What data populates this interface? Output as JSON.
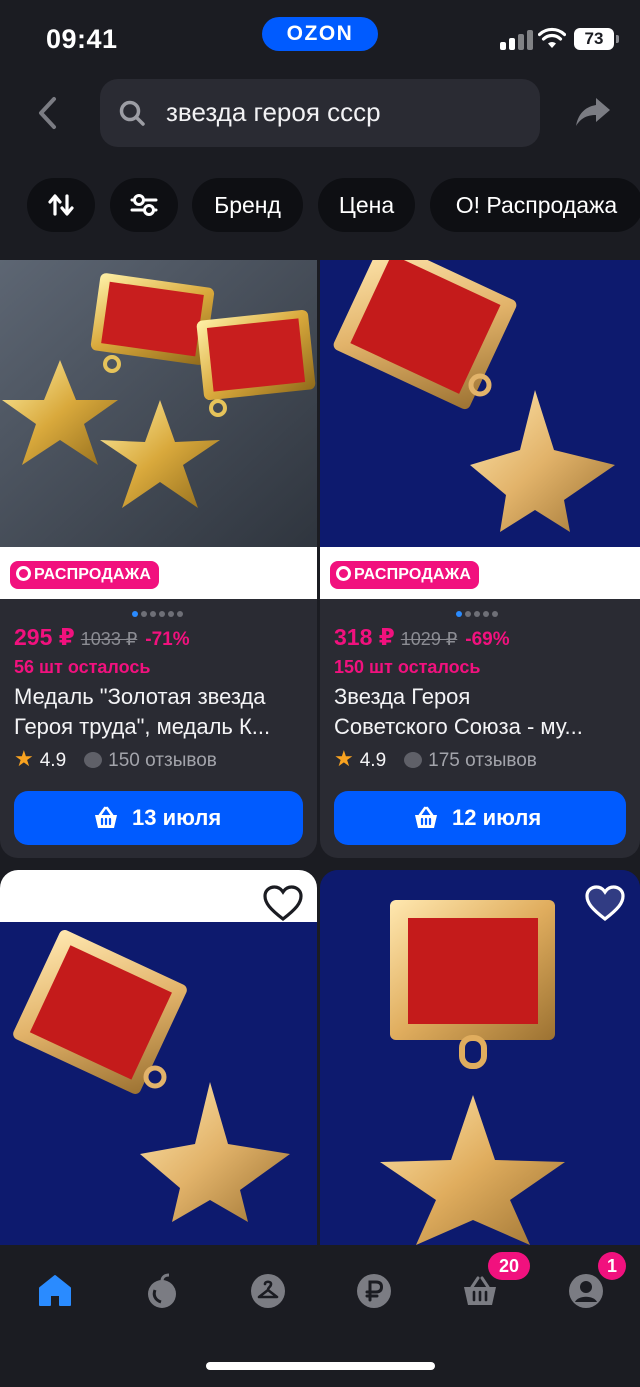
{
  "status_bar": {
    "time": "09:41",
    "brand": "OZON",
    "battery": "73"
  },
  "search": {
    "query": "звезда героя ссср"
  },
  "filters": [
    {
      "label": "",
      "icon": "sort-icon"
    },
    {
      "label": "",
      "icon": "filter-sliders-icon"
    },
    {
      "label": "Бренд"
    },
    {
      "label": "Цена"
    },
    {
      "label": "O! Распродажа"
    }
  ],
  "products": [
    {
      "badge": "РАСПРОДАЖА",
      "price": "295 ₽",
      "old_price": "1033 ₽",
      "discount": "-71%",
      "stock": "56 шт осталось",
      "title_line1": "Медаль \"Золотая звезда",
      "title_line2": "Героя труда\", медаль К...",
      "rating": "4.9",
      "reviews": "150 отзывов",
      "delivery": "13 июля"
    },
    {
      "badge": "РАСПРОДАЖА",
      "price": "318 ₽",
      "old_price": "1029 ₽",
      "discount": "-69%",
      "stock": "150 шт осталось",
      "title_line1": "Звезда Героя",
      "title_line2": "Советского Союза - му...",
      "rating": "4.9",
      "reviews": "175 отзывов",
      "delivery": "12 июля"
    }
  ],
  "bottom_nav": {
    "items": [
      "home-icon",
      "fresh-icon",
      "hanger-icon",
      "ruble-icon",
      "cart-icon",
      "profile-icon"
    ],
    "cart_count": "20",
    "profile_count": "1"
  },
  "colors": {
    "accent": "#005bff",
    "sale": "#f1117e",
    "background": "#1b1c22"
  }
}
